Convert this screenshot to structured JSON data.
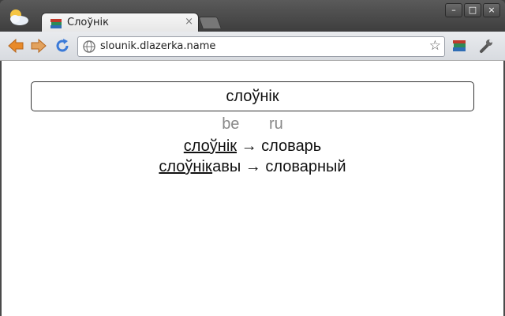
{
  "browser": {
    "tab_title": "Слоўнік",
    "tab_close": "×",
    "url": "slounik.dlazerka.name",
    "win_minimize": "–",
    "win_maximize": "□",
    "win_close": "×"
  },
  "page": {
    "search_value": "слоўнік",
    "languages": [
      "be",
      "ru"
    ],
    "results": [
      {
        "link": "слоўнік",
        "rest": " → словарь"
      },
      {
        "link": "слоўнік",
        "rest": "авы → словарный"
      }
    ]
  },
  "colors": {
    "accent_arrow": "#e88a2a",
    "reload": "#3b7ad8",
    "favicon_red": "#c0392b"
  }
}
